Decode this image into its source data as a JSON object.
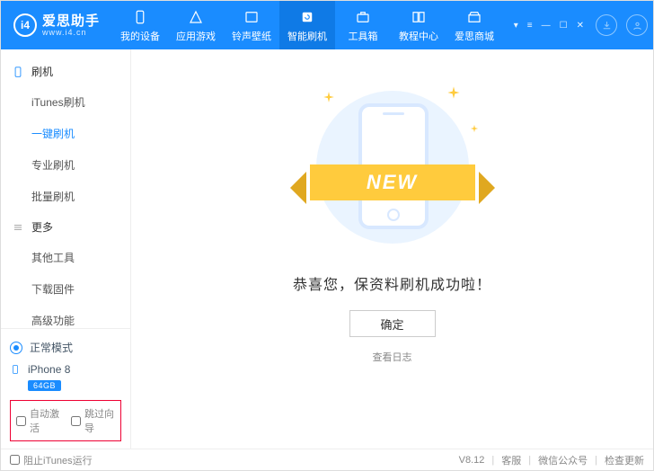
{
  "brand": {
    "name": "爱思助手",
    "sub": "www.i4.cn",
    "logo": "i4"
  },
  "tabs": [
    {
      "label": "我的设备"
    },
    {
      "label": "应用游戏"
    },
    {
      "label": "铃声壁纸"
    },
    {
      "label": "智能刷机"
    },
    {
      "label": "工具箱"
    },
    {
      "label": "教程中心"
    },
    {
      "label": "爱思商城"
    }
  ],
  "sidebar": {
    "cat1": "刷机",
    "items1": [
      "iTunes刷机",
      "一键刷机",
      "专业刷机",
      "批量刷机"
    ],
    "cat2": "更多",
    "items2": [
      "其他工具",
      "下载固件",
      "高级功能"
    ]
  },
  "mode": {
    "label": "正常模式"
  },
  "device": {
    "name": "iPhone 8",
    "badge": "64GB"
  },
  "options": {
    "auto_activate": "自动激活",
    "skip_guide": "跳过向导"
  },
  "main": {
    "ribbon": "NEW",
    "message": "恭喜您，保资料刷机成功啦！",
    "ok": "确定",
    "log": "查看日志"
  },
  "footer": {
    "block_itunes": "阻止iTunes运行",
    "version": "V8.12",
    "support": "客服",
    "wechat": "微信公众号",
    "update": "检查更新"
  }
}
